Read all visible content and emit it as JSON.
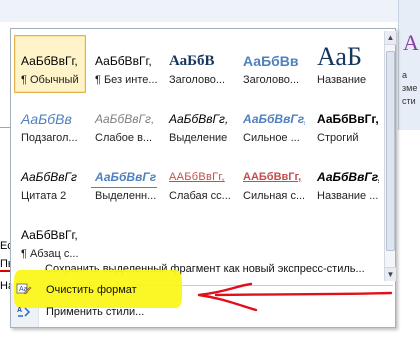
{
  "background": {
    "ribbon_right_letter": "A",
    "ribbon_right_texts": [
      "а",
      "зме",
      "сти"
    ],
    "doc_fragments": [
      "Ес",
      "Пь",
      "На"
    ]
  },
  "styles_gallery": {
    "tiles": [
      {
        "sample": "АаБбВвГг,",
        "name": "¶ Обычный",
        "variant": "s-normal",
        "selected": true
      },
      {
        "sample": "АаБбВвГг,",
        "name": "¶ Без инте...",
        "variant": "s-nospace"
      },
      {
        "sample": "АаБбВ",
        "name": "Заголово...",
        "variant": "s-h1"
      },
      {
        "sample": "АаБбВв",
        "name": "Заголово...",
        "variant": "s-h2"
      },
      {
        "sample": "АаБ",
        "name": "Название",
        "variant": "s-title"
      },
      {
        "sample": "АаБбВв",
        "name": "Подзагол...",
        "variant": "s-subtitle"
      },
      {
        "sample": "АаБбВвГг,",
        "name": "Слабое в...",
        "variant": "s-subtle-em"
      },
      {
        "sample": "АаБбВвГг,",
        "name": "Выделение",
        "variant": "s-emphasis"
      },
      {
        "sample": "АаБбВвГг,",
        "name": "Сильное ...",
        "variant": "s-strong-em"
      },
      {
        "sample": "АаБбВвГг,",
        "name": "Строгий",
        "variant": "s-strong"
      },
      {
        "sample": "АаБбВвГг",
        "name": "Цитата 2",
        "variant": "s-quote"
      },
      {
        "sample": "АаБбВвГг",
        "name": "Выделенн...",
        "variant": "s-int-quote"
      },
      {
        "sample": "ААБбВвГг,",
        "name": "Слабая сс...",
        "variant": "s-subtle-ref"
      },
      {
        "sample": "ААБбВвГг,",
        "name": "Сильная с...",
        "variant": "s-int-ref"
      },
      {
        "sample": "АаБбВвГг,",
        "name": "Название ...",
        "variant": "s-book"
      },
      {
        "sample": "АаБбВвГг,",
        "name": "¶ Абзац с...",
        "variant": "s-list"
      }
    ],
    "scroll_up_icon": "scroll-up-icon",
    "scroll_down_icon": "scroll-down-icon"
  },
  "menu": {
    "save_selection": "Сохранить выделенный фрагмент как новый экспресс-стиль...",
    "clear_formatting": "Очистить формат",
    "apply_styles": "Применить стили..."
  },
  "annotation": {
    "highlight_color": "#fbf51a",
    "arrow_color": "#e0101a"
  }
}
